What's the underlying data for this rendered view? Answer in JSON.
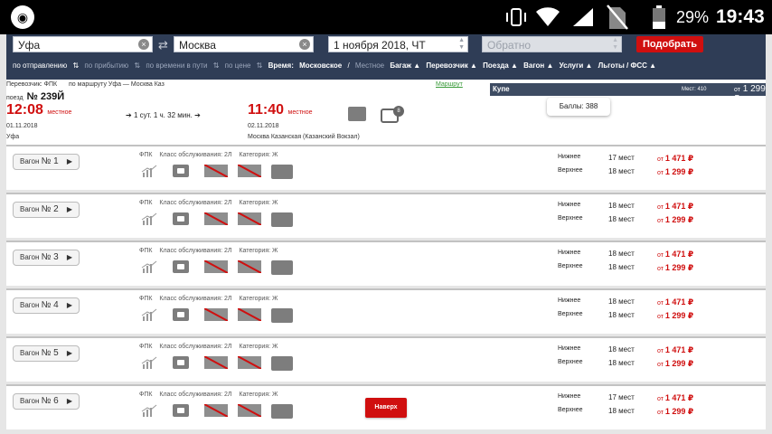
{
  "status": {
    "battery_pct": "29%",
    "time": "19:43"
  },
  "search": {
    "from": "Уфа",
    "to": "Москва",
    "date": "1 ноября 2018, ЧТ",
    "return_placeholder": "Обратно",
    "submit_label": "Подобрать",
    "sort_departure": "по отправлению",
    "sort_arrival": "по прибытию",
    "sort_travel": "по времени в пути",
    "sort_price": "по цене",
    "time_label": "Время:",
    "time_moscow": "Московское",
    "time_sep": "/",
    "time_local": "Местное",
    "filters": [
      "Багаж",
      "Перевозчик",
      "Поезда",
      "Вагон",
      "Услуги",
      "Льготы / ФСС"
    ]
  },
  "train": {
    "carrier": "Перевозчик: ФПК",
    "route_text": "по маршруту Уфа — Москва Каз",
    "route_link": "Маршрут",
    "number_label": "поезд",
    "number": "№ 239Й",
    "dep_time": "12:08",
    "dep_tz": "местное",
    "dep_date": "01.11.2018",
    "dep_station": "Уфа",
    "duration": "1 сут. 1 ч. 32 мин.",
    "arr_time": "11:40",
    "arr_tz": "местное",
    "arr_date": "02.11.2018",
    "arr_station": "Москва Казанская (Казанский Вокзал)",
    "bus_badge": "8",
    "class_name": "Купе",
    "class_seats": "Мест: 410",
    "class_from": "от",
    "class_price": "1 299 ₽",
    "points": "Баллы: 388"
  },
  "wagon_info": {
    "carrier": "ФПК",
    "service": "Класс обслуживания: 2Л",
    "category": "Категория: Ж",
    "lower": "Нижнее",
    "upper": "Верхнее",
    "from": "от",
    "upper_button": "Наверх"
  },
  "wagons": [
    {
      "label": "Вагон",
      "num": "№ 1",
      "lower_count": "17 мест",
      "upper_count": "18 мест",
      "lower_price": "1 471 ₽",
      "upper_price": "1 299 ₽"
    },
    {
      "label": "Вагон",
      "num": "№ 2",
      "lower_count": "18 мест",
      "upper_count": "18 мест",
      "lower_price": "1 471 ₽",
      "upper_price": "1 299 ₽"
    },
    {
      "label": "Вагон",
      "num": "№ 3",
      "lower_count": "18 мест",
      "upper_count": "18 мест",
      "lower_price": "1 471 ₽",
      "upper_price": "1 299 ₽"
    },
    {
      "label": "Вагон",
      "num": "№ 4",
      "lower_count": "18 мест",
      "upper_count": "18 мест",
      "lower_price": "1 471 ₽",
      "upper_price": "1 299 ₽"
    },
    {
      "label": "Вагон",
      "num": "№ 5",
      "lower_count": "18 мест",
      "upper_count": "18 мест",
      "lower_price": "1 471 ₽",
      "upper_price": "1 299 ₽"
    },
    {
      "label": "Вагон",
      "num": "№ 6",
      "lower_count": "17 мест",
      "upper_count": "18 мест",
      "lower_price": "1 471 ₽",
      "upper_price": "1 299 ₽"
    }
  ]
}
